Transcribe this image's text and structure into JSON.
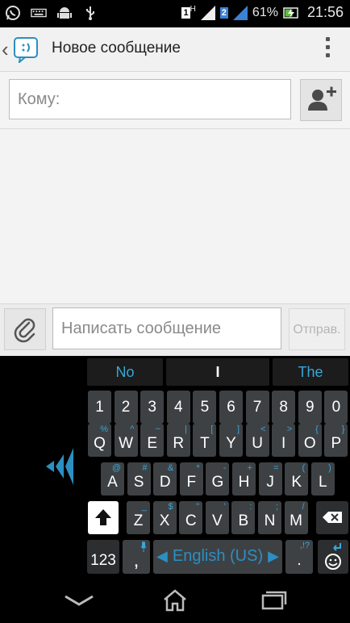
{
  "status_bar": {
    "sim1_label": "1",
    "sim1_network": "H",
    "sim2_label": "2",
    "battery_percent": "61%",
    "time": "21:56",
    "notification_icons": [
      "whatsapp-icon",
      "keyboard-icon",
      "android-icon",
      "usb-icon"
    ]
  },
  "action_bar": {
    "title": "Новое сообщение"
  },
  "recipient": {
    "placeholder": "Кому:"
  },
  "compose": {
    "placeholder": "Написать сообщение",
    "send_label": "Отправ."
  },
  "keyboard": {
    "suggestions": [
      "No",
      "I",
      "The"
    ],
    "number_row": [
      "1",
      "2",
      "3",
      "4",
      "5",
      "6",
      "7",
      "8",
      "9",
      "0"
    ],
    "row1": [
      {
        "main": "Q",
        "alt": "%"
      },
      {
        "main": "W",
        "alt": "^"
      },
      {
        "main": "E",
        "alt": "~"
      },
      {
        "main": "R",
        "alt": "|"
      },
      {
        "main": "T",
        "alt": "["
      },
      {
        "main": "Y",
        "alt": "]"
      },
      {
        "main": "U",
        "alt": "<"
      },
      {
        "main": "I",
        "alt": ">"
      },
      {
        "main": "O",
        "alt": "{"
      },
      {
        "main": "P",
        "alt": "}"
      }
    ],
    "row2": [
      {
        "main": "A",
        "alt": "@"
      },
      {
        "main": "S",
        "alt": "#"
      },
      {
        "main": "D",
        "alt": "&"
      },
      {
        "main": "F",
        "alt": "*"
      },
      {
        "main": "G",
        "alt": "-"
      },
      {
        "main": "H",
        "alt": "+"
      },
      {
        "main": "J",
        "alt": "="
      },
      {
        "main": "K",
        "alt": "("
      },
      {
        "main": "L",
        "alt": ")"
      }
    ],
    "row3": [
      {
        "main": "Z",
        "alt": "_"
      },
      {
        "main": "X",
        "alt": "$"
      },
      {
        "main": "C",
        "alt": "\""
      },
      {
        "main": "V",
        "alt": "'"
      },
      {
        "main": "B",
        "alt": ":"
      },
      {
        "main": "N",
        "alt": ";"
      },
      {
        "main": "M",
        "alt": "/"
      }
    ],
    "numbers_key": "123",
    "comma_key": ",",
    "period_key": ".",
    "period_alt": ",!?",
    "space_label": "English (US)"
  },
  "colors": {
    "accent": "#36a7d8",
    "key_bg": "#3e4144",
    "app_bg": "#f3f3f3"
  }
}
